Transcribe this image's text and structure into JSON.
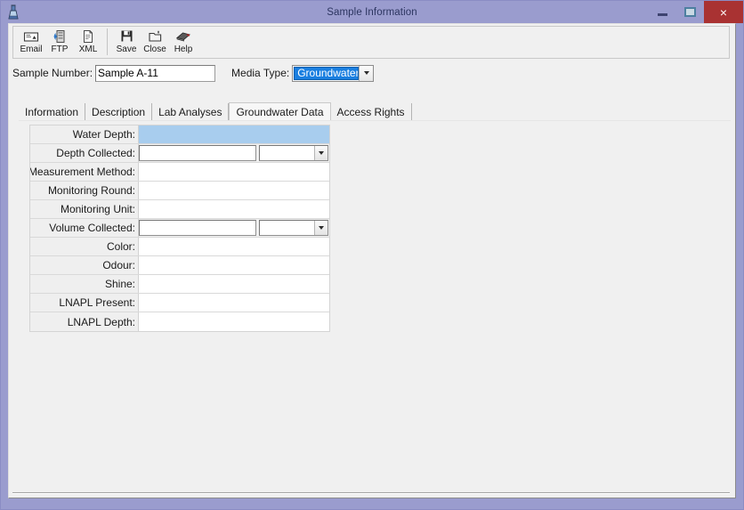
{
  "window": {
    "title": "Sample Information",
    "app_icon": "flask-icon",
    "controls": {
      "minimize": "minimize-icon",
      "maximize": "maximize-icon",
      "close": "×"
    },
    "accent_titlebar": "#9a9cce",
    "close_button_color": "#a93232"
  },
  "toolbar": {
    "buttons": [
      {
        "label": "Email",
        "icon": "envelope-icon"
      },
      {
        "label": "FTP",
        "icon": "server-icon"
      },
      {
        "label": "XML",
        "icon": "document-icon"
      },
      {
        "label": "Save",
        "icon": "floppy-disk-icon"
      },
      {
        "label": "Close",
        "icon": "folder-icon"
      },
      {
        "label": "Help",
        "icon": "help-book-icon"
      }
    ],
    "separator_after_index": 2
  },
  "header": {
    "sample_number_label": "Sample Number:",
    "sample_number_value": "Sample A-11",
    "sample_number_placeholder": "",
    "media_type_label": "Media Type:",
    "media_type_value": "Groundwater",
    "media_type_selected_bg": "#1a7fe0"
  },
  "tabs": [
    {
      "label": "Information",
      "selected": false
    },
    {
      "label": "Description",
      "selected": false
    },
    {
      "label": "Lab Analyses",
      "selected": false
    },
    {
      "label": "Groundwater Data",
      "selected": true
    },
    {
      "label": "Access Rights",
      "selected": false
    }
  ],
  "form": {
    "highlight_color": "#a8cdee",
    "rows": [
      {
        "label": "Water Depth:",
        "value": "",
        "type": "text",
        "highlighted": true
      },
      {
        "label": "Depth Collected:",
        "value": "",
        "unit_value": "",
        "type": "text-with-combo",
        "highlighted": false
      },
      {
        "label": "Measurement Method:",
        "value": "",
        "type": "text",
        "highlighted": false
      },
      {
        "label": "Monitoring Round:",
        "value": "",
        "type": "text",
        "highlighted": false
      },
      {
        "label": "Monitoring Unit:",
        "value": "",
        "type": "text",
        "highlighted": false
      },
      {
        "label": "Volume Collected:",
        "value": "",
        "unit_value": "",
        "type": "text-with-combo",
        "highlighted": false
      },
      {
        "label": "Color:",
        "value": "",
        "type": "text",
        "highlighted": false
      },
      {
        "label": "Odour:",
        "value": "",
        "type": "text",
        "highlighted": false
      },
      {
        "label": "Shine:",
        "value": "",
        "type": "text",
        "highlighted": false
      },
      {
        "label": "LNAPL Present:",
        "value": "",
        "type": "text",
        "highlighted": false
      },
      {
        "label": "LNAPL Depth:",
        "value": "",
        "type": "text",
        "highlighted": false
      }
    ]
  }
}
